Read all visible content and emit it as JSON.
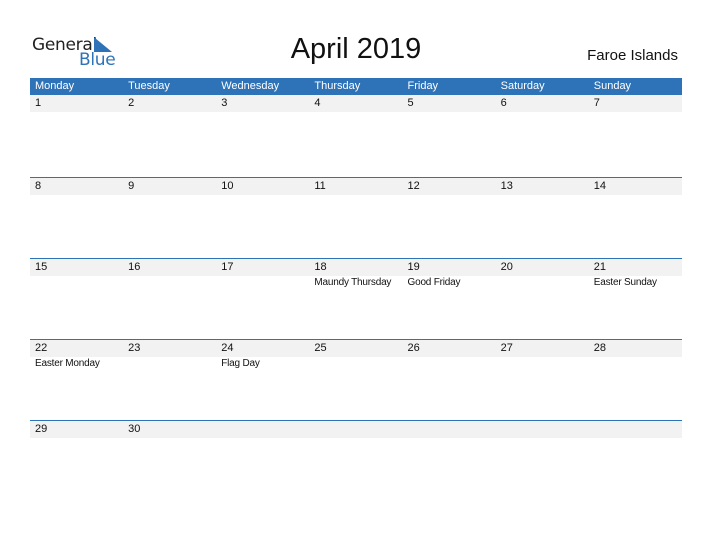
{
  "logo": {
    "line1": "General",
    "line2": "Blue"
  },
  "title": "April 2019",
  "country": "Faroe Islands",
  "colors": {
    "accent": "#2e73b8",
    "band": "#f2f2f2"
  },
  "weekdays": [
    "Monday",
    "Tuesday",
    "Wednesday",
    "Thursday",
    "Friday",
    "Saturday",
    "Sunday"
  ],
  "weeks": [
    [
      {
        "d": "1",
        "e": ""
      },
      {
        "d": "2",
        "e": ""
      },
      {
        "d": "3",
        "e": ""
      },
      {
        "d": "4",
        "e": ""
      },
      {
        "d": "5",
        "e": ""
      },
      {
        "d": "6",
        "e": ""
      },
      {
        "d": "7",
        "e": ""
      }
    ],
    [
      {
        "d": "8",
        "e": ""
      },
      {
        "d": "9",
        "e": ""
      },
      {
        "d": "10",
        "e": ""
      },
      {
        "d": "11",
        "e": ""
      },
      {
        "d": "12",
        "e": ""
      },
      {
        "d": "13",
        "e": ""
      },
      {
        "d": "14",
        "e": ""
      }
    ],
    [
      {
        "d": "15",
        "e": ""
      },
      {
        "d": "16",
        "e": ""
      },
      {
        "d": "17",
        "e": ""
      },
      {
        "d": "18",
        "e": "Maundy Thursday"
      },
      {
        "d": "19",
        "e": "Good Friday"
      },
      {
        "d": "20",
        "e": ""
      },
      {
        "d": "21",
        "e": "Easter Sunday"
      }
    ],
    [
      {
        "d": "22",
        "e": "Easter Monday"
      },
      {
        "d": "23",
        "e": ""
      },
      {
        "d": "24",
        "e": "Flag Day"
      },
      {
        "d": "25",
        "e": ""
      },
      {
        "d": "26",
        "e": ""
      },
      {
        "d": "27",
        "e": ""
      },
      {
        "d": "28",
        "e": ""
      }
    ],
    [
      {
        "d": "29",
        "e": ""
      },
      {
        "d": "30",
        "e": ""
      },
      {
        "d": "",
        "e": ""
      },
      {
        "d": "",
        "e": ""
      },
      {
        "d": "",
        "e": ""
      },
      {
        "d": "",
        "e": ""
      },
      {
        "d": "",
        "e": ""
      }
    ]
  ]
}
